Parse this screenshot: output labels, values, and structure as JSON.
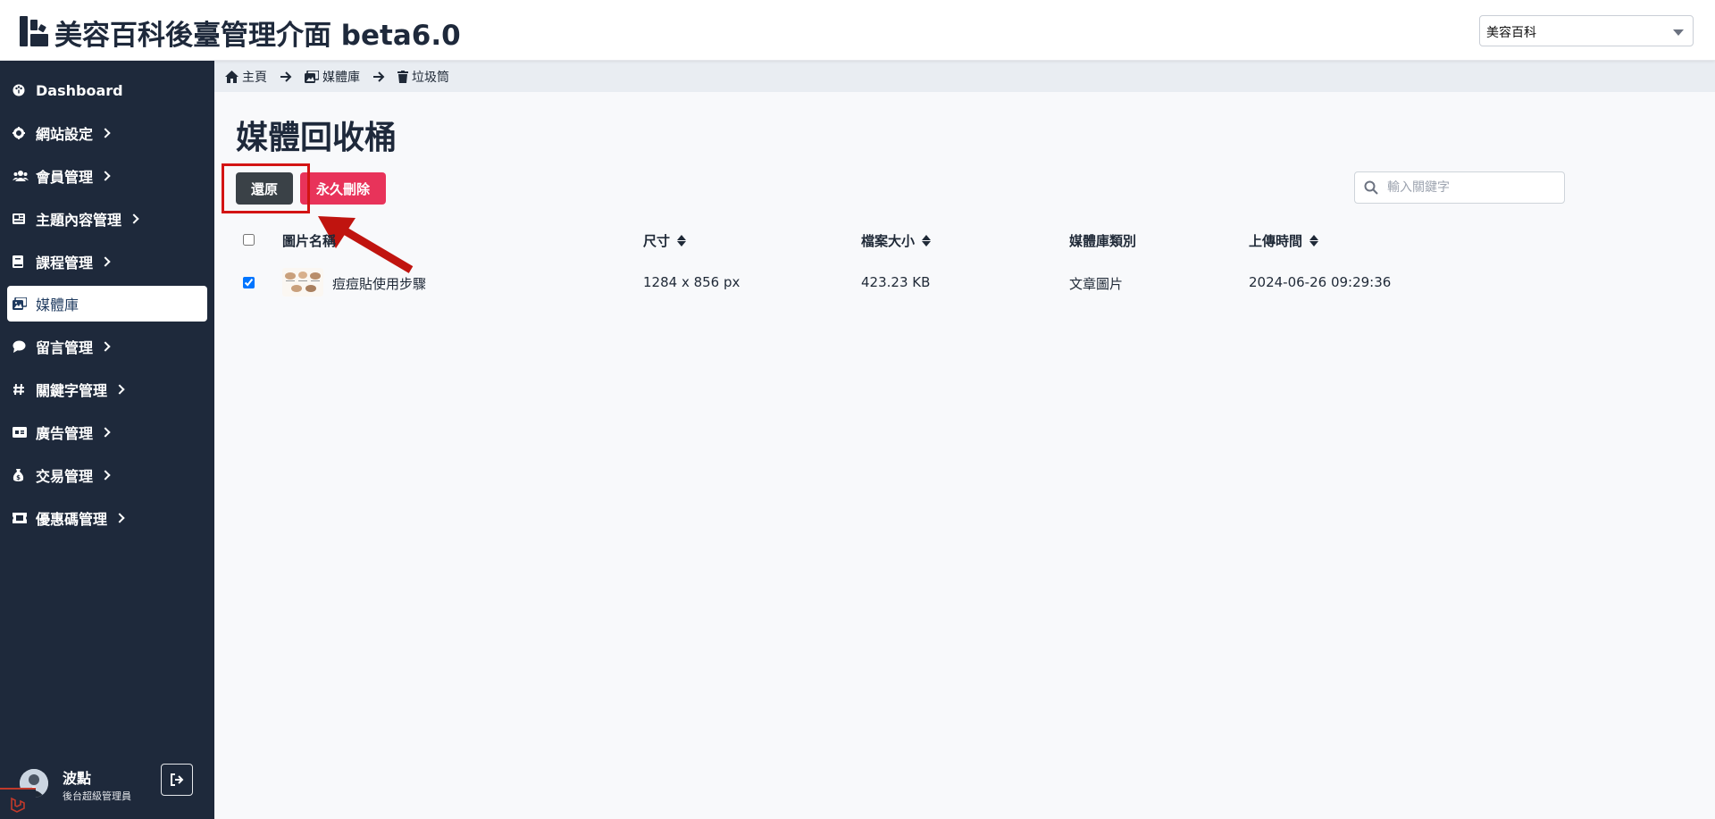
{
  "header": {
    "title": "美容百科後臺管理介面 beta6.0",
    "site_selector": {
      "selected": "美容百科"
    }
  },
  "sidebar": {
    "items": [
      {
        "label": "Dashboard",
        "icon": "palette-icon",
        "has_children": false,
        "active": false
      },
      {
        "label": "網站設定",
        "icon": "gear-icon",
        "has_children": true,
        "active": false
      },
      {
        "label": "會員管理",
        "icon": "users-icon",
        "has_children": true,
        "active": false
      },
      {
        "label": "主題內容管理",
        "icon": "layout-icon",
        "has_children": true,
        "active": false
      },
      {
        "label": "課程管理",
        "icon": "book-icon",
        "has_children": true,
        "active": false
      },
      {
        "label": "媒體庫",
        "icon": "images-icon",
        "has_children": false,
        "active": true
      },
      {
        "label": "留言管理",
        "icon": "comment-icon",
        "has_children": true,
        "active": false
      },
      {
        "label": "關鍵字管理",
        "icon": "hashtag-icon",
        "has_children": true,
        "active": false
      },
      {
        "label": "廣告管理",
        "icon": "ad-icon",
        "has_children": true,
        "active": false
      },
      {
        "label": "交易管理",
        "icon": "money-bag-icon",
        "has_children": true,
        "active": false
      },
      {
        "label": "優惠碼管理",
        "icon": "ticket-icon",
        "has_children": true,
        "active": false
      }
    ],
    "user": {
      "name": "波點",
      "role": "後台超級管理員"
    }
  },
  "breadcrumb": {
    "items": [
      {
        "label": "主頁",
        "icon": "home-icon"
      },
      {
        "label": "媒體庫",
        "icon": "images-icon"
      },
      {
        "label": "垃圾筒",
        "icon": "trash-icon"
      }
    ]
  },
  "main": {
    "title": "媒體回收桶",
    "restore_label": "還原",
    "delete_label": "永久刪除",
    "search": {
      "placeholder": "輸入關鍵字",
      "value": ""
    },
    "table": {
      "columns": [
        {
          "label": "圖片名稱",
          "sortable": false
        },
        {
          "label": "尺寸",
          "sortable": true
        },
        {
          "label": "檔案大小",
          "sortable": true
        },
        {
          "label": "媒體庫類別",
          "sortable": false
        },
        {
          "label": "上傳時間",
          "sortable": true
        }
      ],
      "rows": [
        {
          "checked": true,
          "name": "痘痘貼使用步驟",
          "size": "1284 x 856 px",
          "filesize": "423.23 KB",
          "category": "文章圖片",
          "uploaded": "2024-06-26 09:29:36"
        }
      ]
    }
  },
  "colors": {
    "sidebar_bg": "#1e293b",
    "restore_btn": "#3a4147",
    "delete_btn": "#e8335a",
    "annotation": "#d31414"
  }
}
